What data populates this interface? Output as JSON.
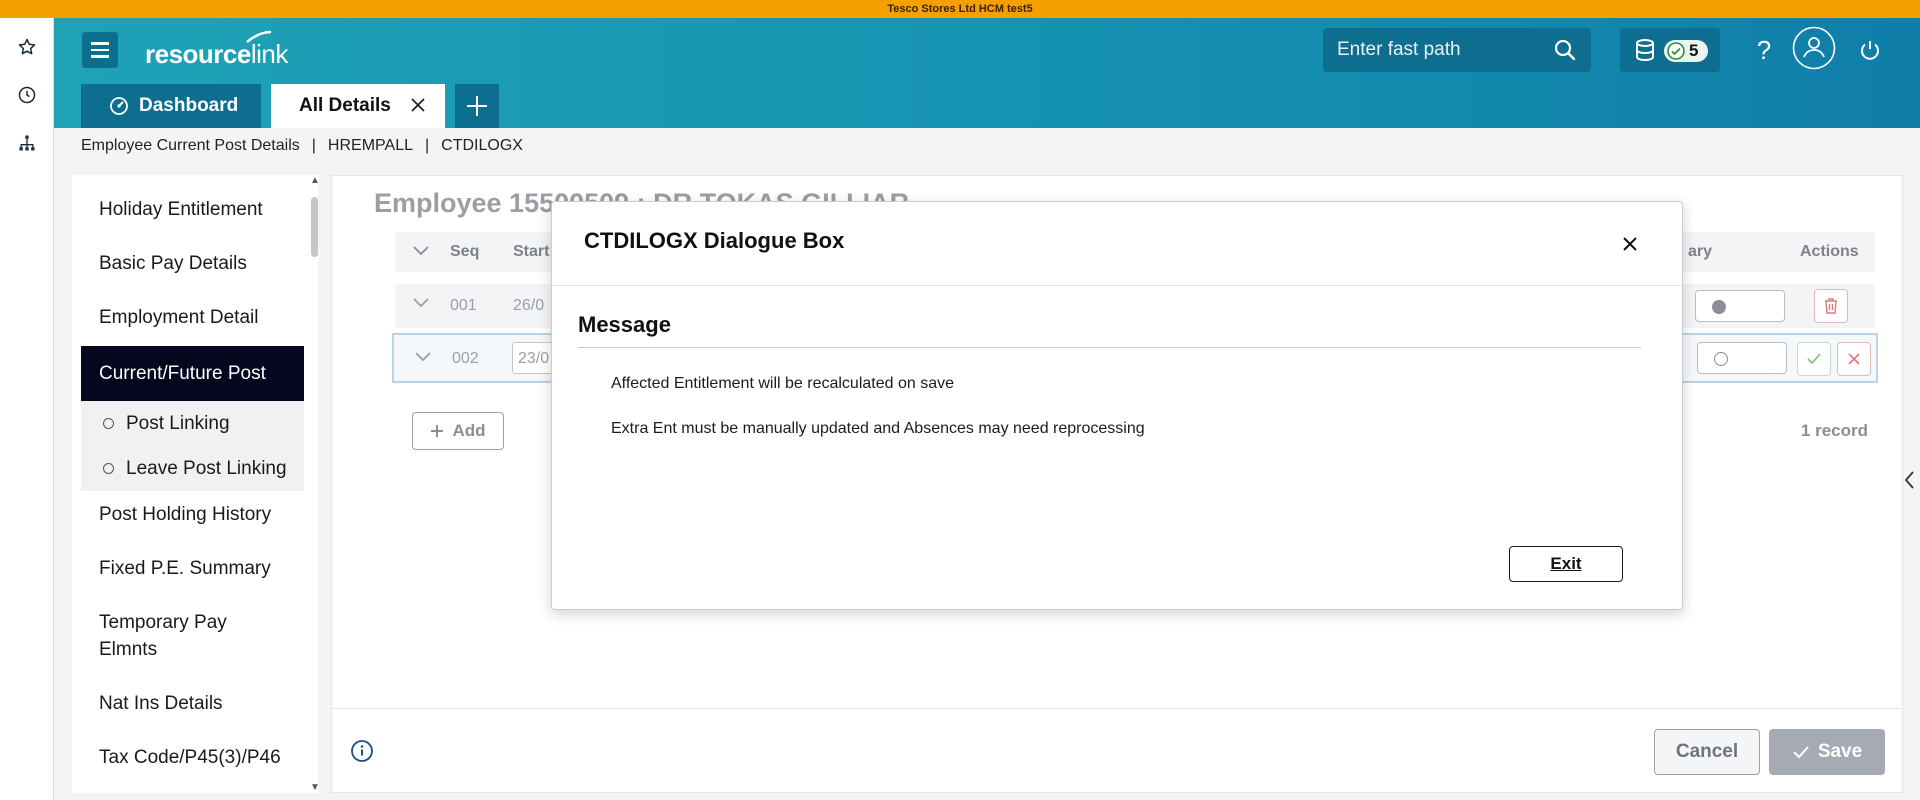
{
  "env_banner": "Tesco Stores Ltd HCM test5",
  "header": {
    "logo_part1": "resource",
    "logo_part2": "link",
    "fast_path_placeholder": "Enter fast path",
    "badge_count": "5"
  },
  "tabs": {
    "dashboard": "Dashboard",
    "all_details": "All Details"
  },
  "breadcrumb": [
    "Employee Current Post Details",
    "HREMPALL",
    "CTDILOGX"
  ],
  "leftnav": {
    "items": [
      "Holiday Entitlement",
      "Basic Pay Details",
      "Employment Detail",
      "Current/Future Post",
      "Post Holding History",
      "Fixed P.E. Summary",
      "Temporary Pay Elmnts",
      "Nat Ins Details",
      "Tax Code/P45(3)/P46"
    ],
    "subitems": [
      "Post Linking",
      "Leave Post Linking"
    ]
  },
  "main": {
    "employee_title": "Employee 15500509 : DR TOKAS GILLIAR",
    "columns": {
      "seq": "Seq",
      "start": "Start",
      "primary": "ary",
      "actions": "Actions"
    },
    "rows": [
      {
        "seq": "001",
        "start": "26/0"
      },
      {
        "seq": "002",
        "start": "23/0"
      }
    ],
    "add_label": "Add",
    "record_count": "1 record",
    "cancel_label": "Cancel",
    "save_label": "Save"
  },
  "dialog": {
    "title": "CTDILOGX Dialogue Box",
    "section": "Message",
    "messages": [
      "Affected Entitlement will be recalculated on save",
      "Extra Ent must be manually updated and Absences may need reprocessing"
    ],
    "exit_label": "Exit"
  },
  "colors": {
    "banner": "#f5a000",
    "header_teal": "#1692b1",
    "tab_dark": "#0e6e8f",
    "nav_active": "#06061f"
  }
}
